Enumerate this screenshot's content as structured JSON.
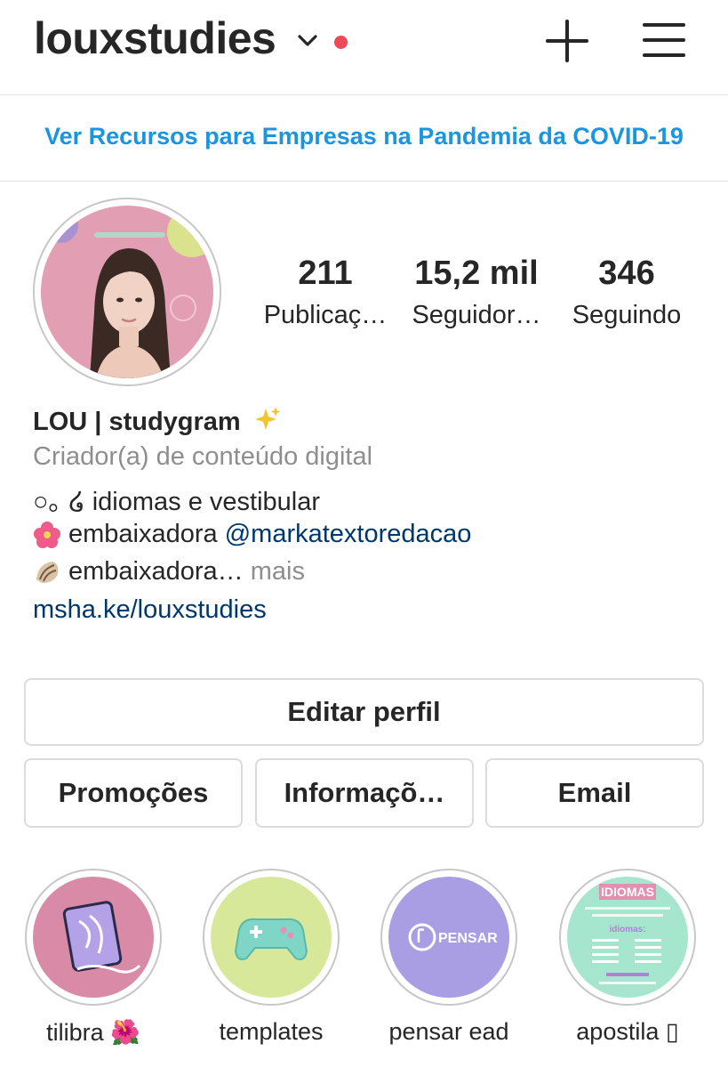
{
  "header": {
    "username": "louxstudies"
  },
  "banner": {
    "text": "Ver Recursos para Empresas na Pandemia da COVID-19"
  },
  "stats": [
    {
      "value": "211",
      "label": "Publicaç…"
    },
    {
      "value": "15,2 mil",
      "label": "Seguidor…"
    },
    {
      "value": "346",
      "label": "Seguindo"
    }
  ],
  "bio": {
    "name": "LOU | studygram",
    "category": "Criador(a) de conteúdo digital",
    "line1": "○｡ ໒ idiomas e vestibular",
    "line2_text": "embaixadora ",
    "line2_mention": "@markatextoredacao",
    "line3_text": "embaixadora…",
    "line3_more": " mais",
    "link": "msha.ke/louxstudies"
  },
  "buttons": {
    "edit": "Editar perfil",
    "promo": "Promoções",
    "info": "Informaçõ…",
    "email": "Email"
  },
  "highlights": [
    {
      "label": "tilibra 🌺",
      "color": "#d98aa6"
    },
    {
      "label": "templates",
      "color": "#d7e89a"
    },
    {
      "label": "pensar ead",
      "color": "#a99ee3",
      "inner_text": "PENSAR"
    },
    {
      "label": "apostila ▯",
      "color": "#a6e6cf",
      "inner_title": "IDIOMAS",
      "inner_sub": "idiomas:"
    }
  ],
  "colors": {
    "accent_link": "#1b95e0",
    "mention": "#00376b",
    "notification_dot": "#ed4956"
  }
}
